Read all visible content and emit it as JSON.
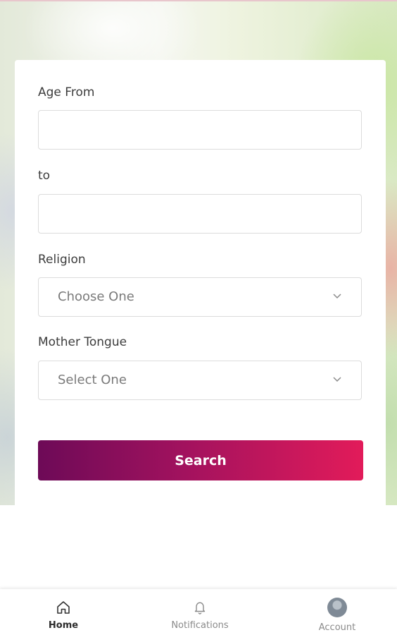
{
  "form": {
    "age_from_label": "Age From",
    "age_from_value": "",
    "to_label": "to",
    "to_value": "",
    "religion_label": "Religion",
    "religion_value": "Choose One",
    "mother_tongue_label": "Mother Tongue",
    "mother_tongue_value": "Select One",
    "search_label": "Search"
  },
  "nav": {
    "items": [
      {
        "label": "Home",
        "icon": "home-icon",
        "active": true
      },
      {
        "label": "Notifications",
        "icon": "bell-icon",
        "active": false
      },
      {
        "label": "Account",
        "icon": "avatar",
        "active": false
      }
    ]
  },
  "colors": {
    "button_gradient_start": "#6d0a57",
    "button_gradient_end": "#e21b5a"
  }
}
